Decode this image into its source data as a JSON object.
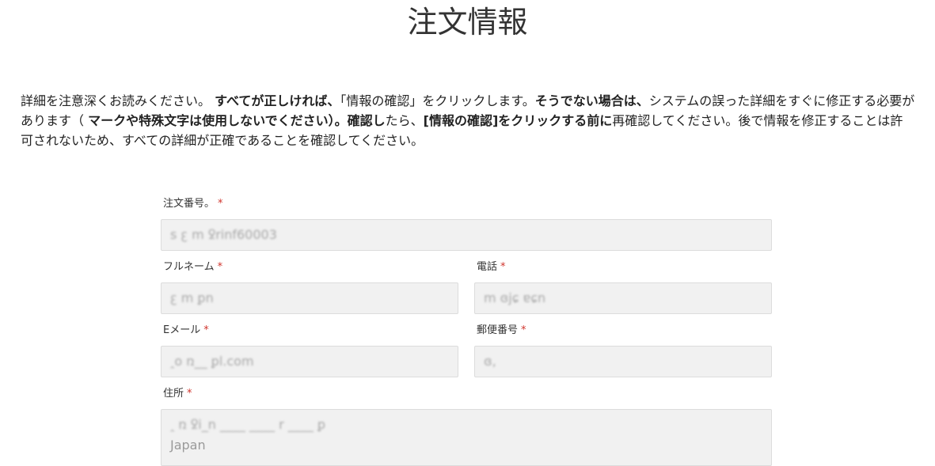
{
  "page": {
    "title": "注文情報"
  },
  "instructions": {
    "part1": "詳細を注意深くお読みください。 ",
    "part2_bold": "すべてが正しければ、",
    "part3": "「情報の確認」をクリックします。",
    "part4_bold": "そうでない場合は、",
    "part5": "システムの誤った詳細をすぐに修正する必要があります（ ",
    "part6_bold": "マークや特殊文字は使用しないでください）。確認し",
    "part7": "たら、",
    "part8_bold": "[情報の確認]をクリックする前に",
    "part9": "再確認してください。後で情報を修正することは許可されないため、すべての詳細が正確であることを確認してください。"
  },
  "form": {
    "required_mark": "*",
    "order_number": {
      "label": "注文番号。",
      "value": "ꜱ  ꜫ m  ꝿrinf60003"
    },
    "full_name": {
      "label": "フルネーム",
      "value": "ꜫ m ꝑn"
    },
    "phone": {
      "label": "電話",
      "value": "m   ɞjɕ ɐɕn"
    },
    "email": {
      "label": "Eメール",
      "value": "ꞈo    ռ__       ꝑl.com"
    },
    "postal_code": {
      "label": "郵便番号",
      "value": "ɞ,"
    },
    "address": {
      "label": "住所",
      "line1": "ꞈ ռ ꝿi_n  ____ ____  r ____ ꝑ",
      "line2": "Japan"
    }
  }
}
